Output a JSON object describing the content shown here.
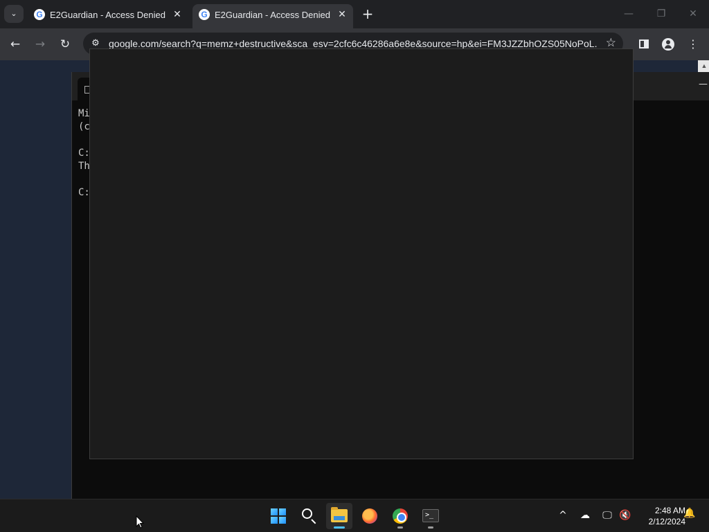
{
  "browser": {
    "tabs": [
      {
        "title": "E2Guardian - Access Denied",
        "favicon": "google-g-icon",
        "active": false
      },
      {
        "title": "E2Guardian - Access Denied",
        "favicon": "google-g-icon",
        "active": true
      }
    ],
    "tab_close_glyph": "✕",
    "new_tab_glyph": "+",
    "tab_search_glyph": "⌄",
    "window_controls": {
      "minimize": "—",
      "restore": "❐",
      "close": "✕"
    },
    "nav": {
      "back": "←",
      "forward": "→",
      "reload": "↻"
    },
    "omnibox": {
      "url": "google.com/search?q=memz+destructive&sca_esv=2cfc6c46286a6e8e&source=hp&ei=FM3JZZbhOZS05NoPoL...",
      "site_info_glyph": "⚙",
      "bookmark_glyph": "☆"
    }
  },
  "console": {
    "lines": [
      "Mi",
      "(c",
      "",
      "C:",
      "Th",
      "",
      "C:"
    ],
    "minimize_glyph": "—",
    "scroll_up_glyph": "▲"
  },
  "taskbar": {
    "apps": [
      {
        "name": "start-button",
        "icon": "windows-logo-icon"
      },
      {
        "name": "search-button",
        "icon": "search-icon"
      },
      {
        "name": "file-explorer-button",
        "icon": "folder-icon"
      },
      {
        "name": "firefox-button",
        "icon": "firefox-icon"
      },
      {
        "name": "chrome-button",
        "icon": "chrome-icon"
      },
      {
        "name": "terminal-button",
        "icon": "terminal-icon"
      }
    ],
    "terminal_glyph": ">_",
    "tray": {
      "chevron": "^",
      "onedrive": "☁",
      "network": "🖵",
      "volume": "🔇",
      "bell": "🔔"
    },
    "time": "2:48 AM",
    "date": "2/12/2024"
  },
  "colors": {
    "tabstrip": "#202124",
    "toolbar": "#35363a",
    "omnibox": "#202124",
    "popup": "#1c1c1c",
    "console": "#0c0c0c",
    "taskbar": "#1b1b1b",
    "accent": "#4cc2ff"
  }
}
